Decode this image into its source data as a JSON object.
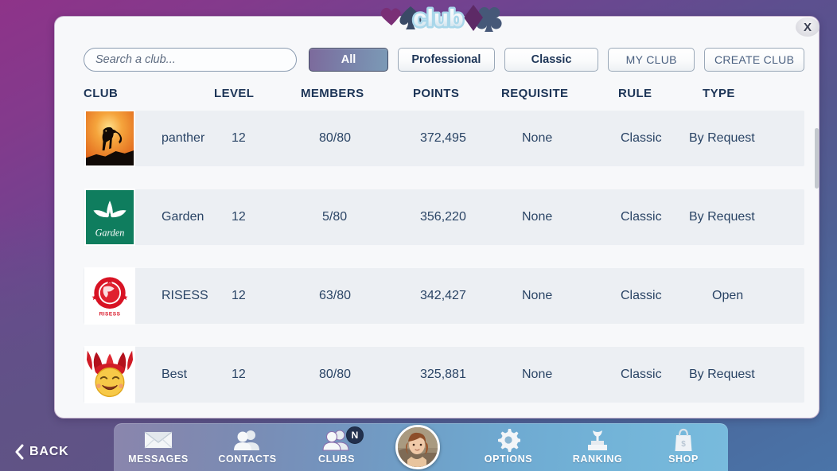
{
  "app": {
    "logo_text": "club",
    "close_label": "X"
  },
  "search": {
    "placeholder": "Search a club...",
    "value": ""
  },
  "filters": [
    {
      "label": "All",
      "active": true
    },
    {
      "label": "Professional",
      "active": false
    },
    {
      "label": "Classic",
      "active": false
    },
    {
      "label": "MY CLUB",
      "active": false
    },
    {
      "label": "CREATE CLUB",
      "active": false
    }
  ],
  "table": {
    "headers": [
      "CLUB",
      "LEVEL",
      "MEMBERS",
      "POINTS",
      "REQUISITE",
      "RULE",
      "TYPE"
    ],
    "rows": [
      {
        "club": "panther",
        "level": "12",
        "members": "80/80",
        "points": "372,495",
        "requisite": "None",
        "rule": "Classic",
        "type": "By Request",
        "avatar": "panther-emblem"
      },
      {
        "club": "Garden",
        "level": "12",
        "members": "5/80",
        "points": "356,220",
        "requisite": "None",
        "rule": "Classic",
        "type": "By Request",
        "avatar": "garden-emblem"
      },
      {
        "club": "RISESS",
        "level": "12",
        "members": "63/80",
        "points": "342,427",
        "requisite": "None",
        "rule": "Classic",
        "type": "Open",
        "avatar": "risess-emblem"
      },
      {
        "club": "Best",
        "level": "12",
        "members": "80/80",
        "points": "325,881",
        "requisite": "None",
        "rule": "Classic",
        "type": "By Request",
        "avatar": "joker-emblem"
      }
    ]
  },
  "bottom_nav": {
    "back_label": "BACK",
    "items": [
      {
        "label": "MESSAGES",
        "icon": "envelope-icon",
        "badge": ""
      },
      {
        "label": "CONTACTS",
        "icon": "contacts-icon",
        "badge": ""
      },
      {
        "label": "CLUBS",
        "icon": "clubs-icon",
        "badge": "N"
      },
      {
        "label": "OPTIONS",
        "icon": "gear-icon",
        "badge": ""
      },
      {
        "label": "RANKING",
        "icon": "trophy-icon",
        "badge": ""
      },
      {
        "label": "SHOP",
        "icon": "shopping-bag-icon",
        "badge": ""
      }
    ]
  },
  "colors": {
    "accent_purple": "#8e3389",
    "accent_blue": "#4a74a8",
    "header_text": "#1d3557",
    "row_bg": "#eceff3",
    "badge_bg": "#22304d"
  }
}
